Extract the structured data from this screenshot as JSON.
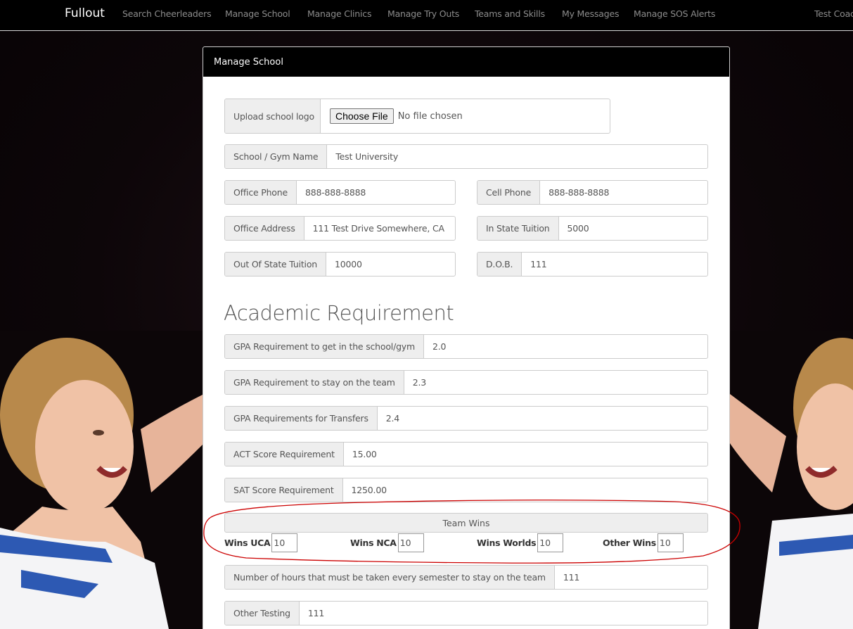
{
  "navbar": {
    "brand": "Fullout",
    "links": [
      {
        "label": "Search Cheerleaders"
      },
      {
        "label": "Manage School"
      },
      {
        "label": "Manage Clinics"
      },
      {
        "label": "Manage Try Outs"
      },
      {
        "label": "Teams and Skills"
      },
      {
        "label": "My Messages"
      },
      {
        "label": "Manage SOS Alerts"
      },
      {
        "label": "Test Coac"
      }
    ]
  },
  "panel": {
    "heading": "Manage School"
  },
  "logo_upload": {
    "label": "Upload school logo",
    "button": "Choose File",
    "status": "No file chosen"
  },
  "fields": {
    "school_name": {
      "label": "School / Gym Name",
      "value": "Test University"
    },
    "office_phone": {
      "label": "Office Phone",
      "value": "888-888-8888"
    },
    "cell_phone": {
      "label": "Cell Phone",
      "value": "888-888-8888"
    },
    "office_address": {
      "label": "Office Address",
      "value": "111 Test Drive Somewhere, CA"
    },
    "in_state_tuition": {
      "label": "In State Tuition",
      "value": "5000"
    },
    "out_state_tuition": {
      "label": "Out Of State Tuition",
      "value": "10000"
    },
    "dob": {
      "label": "D.O.B.",
      "value": "111"
    }
  },
  "academic": {
    "title": "Academic Requirement",
    "gpa_in": {
      "label": "GPA Requirement to get in the school/gym",
      "value": "2.0"
    },
    "gpa_stay": {
      "label": "GPA Requirement to stay on the team",
      "value": "2.3"
    },
    "gpa_transfer": {
      "label": "GPA Requirements for Transfers",
      "value": "2.4"
    },
    "act": {
      "label": "ACT Score Requirement",
      "value": "15.00"
    },
    "sat": {
      "label": "SAT Score Requirement",
      "value": "1250.00"
    }
  },
  "team_wins": {
    "title": "Team Wins",
    "uca": {
      "label": "Wins UCA",
      "value": "10"
    },
    "nca": {
      "label": "Wins NCA",
      "value": "10"
    },
    "worlds": {
      "label": "Wins Worlds",
      "value": "10"
    },
    "other": {
      "label": "Other Wins",
      "value": "10"
    }
  },
  "extra": {
    "hours": {
      "label": "Number of hours that must be taken every semester to stay on the team",
      "value": "111"
    },
    "other_testing": {
      "label": "Other Testing",
      "value": "111"
    }
  },
  "colors": {
    "navbar_bg": "#000000",
    "annotation": "#cc0000",
    "addon_bg": "#eeeeee"
  }
}
